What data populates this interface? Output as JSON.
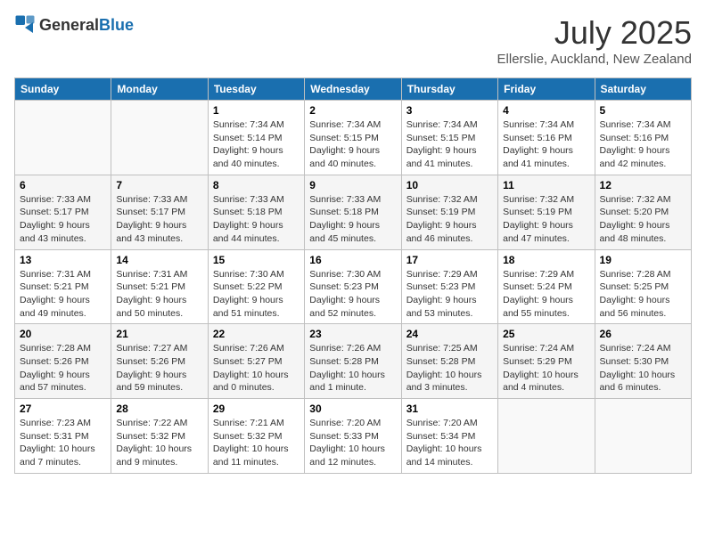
{
  "header": {
    "logo_general": "General",
    "logo_blue": "Blue",
    "title": "July 2025",
    "location": "Ellerslie, Auckland, New Zealand"
  },
  "days_of_week": [
    "Sunday",
    "Monday",
    "Tuesday",
    "Wednesday",
    "Thursday",
    "Friday",
    "Saturday"
  ],
  "weeks": [
    [
      {
        "day": "",
        "info": ""
      },
      {
        "day": "",
        "info": ""
      },
      {
        "day": "1",
        "info": "Sunrise: 7:34 AM\nSunset: 5:14 PM\nDaylight: 9 hours and 40 minutes."
      },
      {
        "day": "2",
        "info": "Sunrise: 7:34 AM\nSunset: 5:15 PM\nDaylight: 9 hours and 40 minutes."
      },
      {
        "day": "3",
        "info": "Sunrise: 7:34 AM\nSunset: 5:15 PM\nDaylight: 9 hours and 41 minutes."
      },
      {
        "day": "4",
        "info": "Sunrise: 7:34 AM\nSunset: 5:16 PM\nDaylight: 9 hours and 41 minutes."
      },
      {
        "day": "5",
        "info": "Sunrise: 7:34 AM\nSunset: 5:16 PM\nDaylight: 9 hours and 42 minutes."
      }
    ],
    [
      {
        "day": "6",
        "info": "Sunrise: 7:33 AM\nSunset: 5:17 PM\nDaylight: 9 hours and 43 minutes."
      },
      {
        "day": "7",
        "info": "Sunrise: 7:33 AM\nSunset: 5:17 PM\nDaylight: 9 hours and 43 minutes."
      },
      {
        "day": "8",
        "info": "Sunrise: 7:33 AM\nSunset: 5:18 PM\nDaylight: 9 hours and 44 minutes."
      },
      {
        "day": "9",
        "info": "Sunrise: 7:33 AM\nSunset: 5:18 PM\nDaylight: 9 hours and 45 minutes."
      },
      {
        "day": "10",
        "info": "Sunrise: 7:32 AM\nSunset: 5:19 PM\nDaylight: 9 hours and 46 minutes."
      },
      {
        "day": "11",
        "info": "Sunrise: 7:32 AM\nSunset: 5:19 PM\nDaylight: 9 hours and 47 minutes."
      },
      {
        "day": "12",
        "info": "Sunrise: 7:32 AM\nSunset: 5:20 PM\nDaylight: 9 hours and 48 minutes."
      }
    ],
    [
      {
        "day": "13",
        "info": "Sunrise: 7:31 AM\nSunset: 5:21 PM\nDaylight: 9 hours and 49 minutes."
      },
      {
        "day": "14",
        "info": "Sunrise: 7:31 AM\nSunset: 5:21 PM\nDaylight: 9 hours and 50 minutes."
      },
      {
        "day": "15",
        "info": "Sunrise: 7:30 AM\nSunset: 5:22 PM\nDaylight: 9 hours and 51 minutes."
      },
      {
        "day": "16",
        "info": "Sunrise: 7:30 AM\nSunset: 5:23 PM\nDaylight: 9 hours and 52 minutes."
      },
      {
        "day": "17",
        "info": "Sunrise: 7:29 AM\nSunset: 5:23 PM\nDaylight: 9 hours and 53 minutes."
      },
      {
        "day": "18",
        "info": "Sunrise: 7:29 AM\nSunset: 5:24 PM\nDaylight: 9 hours and 55 minutes."
      },
      {
        "day": "19",
        "info": "Sunrise: 7:28 AM\nSunset: 5:25 PM\nDaylight: 9 hours and 56 minutes."
      }
    ],
    [
      {
        "day": "20",
        "info": "Sunrise: 7:28 AM\nSunset: 5:26 PM\nDaylight: 9 hours and 57 minutes."
      },
      {
        "day": "21",
        "info": "Sunrise: 7:27 AM\nSunset: 5:26 PM\nDaylight: 9 hours and 59 minutes."
      },
      {
        "day": "22",
        "info": "Sunrise: 7:26 AM\nSunset: 5:27 PM\nDaylight: 10 hours and 0 minutes."
      },
      {
        "day": "23",
        "info": "Sunrise: 7:26 AM\nSunset: 5:28 PM\nDaylight: 10 hours and 1 minute."
      },
      {
        "day": "24",
        "info": "Sunrise: 7:25 AM\nSunset: 5:28 PM\nDaylight: 10 hours and 3 minutes."
      },
      {
        "day": "25",
        "info": "Sunrise: 7:24 AM\nSunset: 5:29 PM\nDaylight: 10 hours and 4 minutes."
      },
      {
        "day": "26",
        "info": "Sunrise: 7:24 AM\nSunset: 5:30 PM\nDaylight: 10 hours and 6 minutes."
      }
    ],
    [
      {
        "day": "27",
        "info": "Sunrise: 7:23 AM\nSunset: 5:31 PM\nDaylight: 10 hours and 7 minutes."
      },
      {
        "day": "28",
        "info": "Sunrise: 7:22 AM\nSunset: 5:32 PM\nDaylight: 10 hours and 9 minutes."
      },
      {
        "day": "29",
        "info": "Sunrise: 7:21 AM\nSunset: 5:32 PM\nDaylight: 10 hours and 11 minutes."
      },
      {
        "day": "30",
        "info": "Sunrise: 7:20 AM\nSunset: 5:33 PM\nDaylight: 10 hours and 12 minutes."
      },
      {
        "day": "31",
        "info": "Sunrise: 7:20 AM\nSunset: 5:34 PM\nDaylight: 10 hours and 14 minutes."
      },
      {
        "day": "",
        "info": ""
      },
      {
        "day": "",
        "info": ""
      }
    ]
  ]
}
